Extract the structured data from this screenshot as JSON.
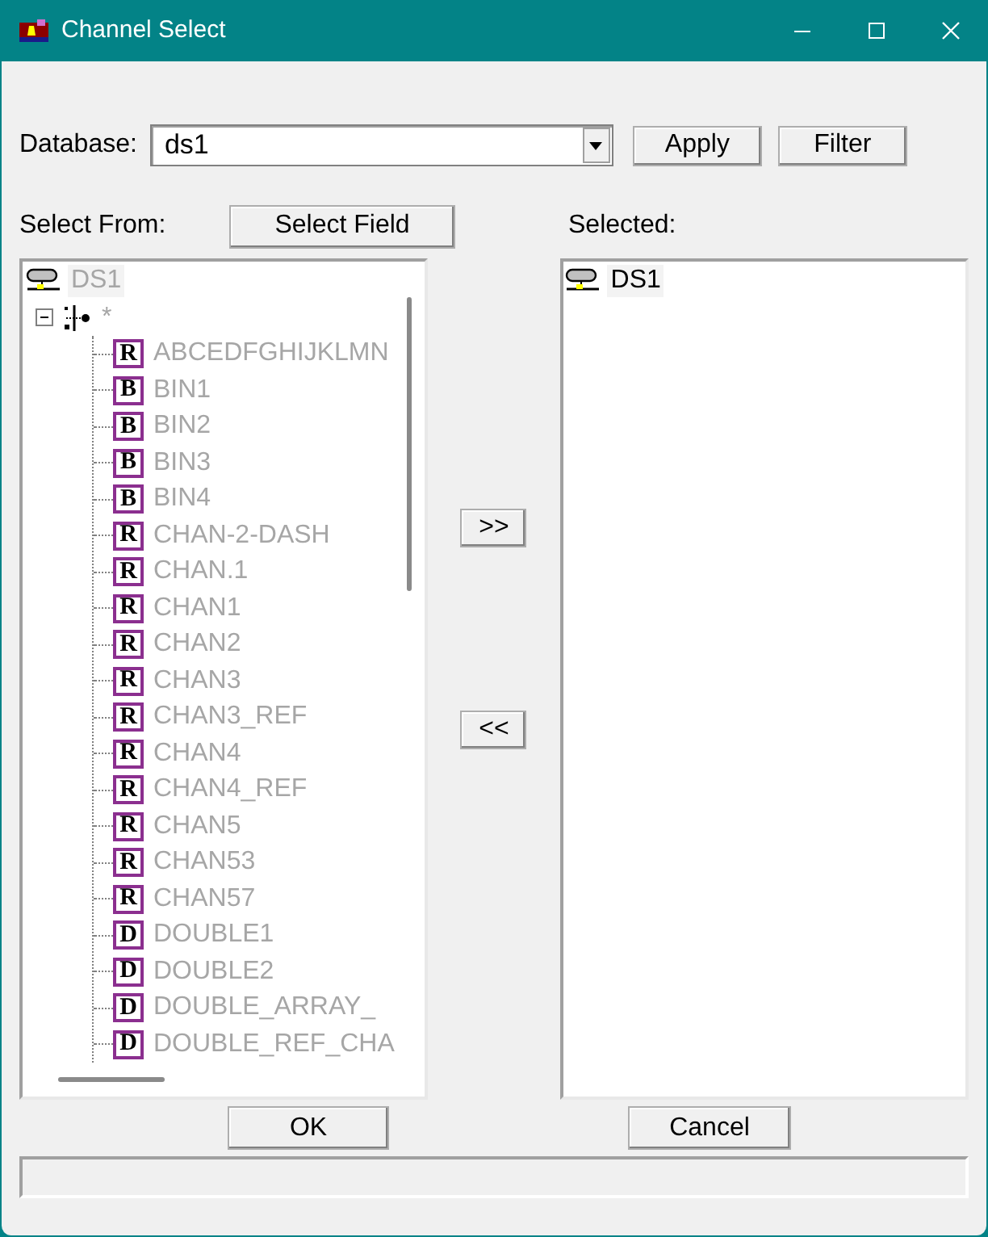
{
  "window": {
    "title": "Channel Select"
  },
  "database": {
    "label": "Database:",
    "value": "ds1"
  },
  "buttons": {
    "apply": "Apply",
    "filter": "Filter",
    "select_field": "Select Field",
    "add": ">>",
    "remove": "<<",
    "ok": "OK",
    "cancel": "Cancel"
  },
  "select_from": {
    "label": "Select From:",
    "tree": [
      {
        "label": "DS1",
        "kind": "database",
        "disabled": true,
        "children": [
          {
            "label": "*",
            "kind": "group",
            "disabled": true,
            "expanded": true,
            "children": [
              {
                "label": "ABCEDFGHIJKLMN",
                "kind": "field",
                "badge": "R",
                "disabled": true
              },
              {
                "label": "BIN1",
                "kind": "field",
                "badge": "B",
                "disabled": true
              },
              {
                "label": "BIN2",
                "kind": "field",
                "badge": "B",
                "disabled": true
              },
              {
                "label": "BIN3",
                "kind": "field",
                "badge": "B",
                "disabled": true
              },
              {
                "label": "BIN4",
                "kind": "field",
                "badge": "B",
                "disabled": true
              },
              {
                "label": "CHAN-2-DASH",
                "kind": "field",
                "badge": "R",
                "disabled": true
              },
              {
                "label": "CHAN.1",
                "kind": "field",
                "badge": "R",
                "disabled": true
              },
              {
                "label": "CHAN1",
                "kind": "field",
                "badge": "R",
                "disabled": true
              },
              {
                "label": "CHAN2",
                "kind": "field",
                "badge": "R",
                "disabled": true
              },
              {
                "label": "CHAN3",
                "kind": "field",
                "badge": "R",
                "disabled": true
              },
              {
                "label": "CHAN3_REF",
                "kind": "field",
                "badge": "R",
                "disabled": true
              },
              {
                "label": "CHAN4",
                "kind": "field",
                "badge": "R",
                "disabled": true
              },
              {
                "label": "CHAN4_REF",
                "kind": "field",
                "badge": "R",
                "disabled": true
              },
              {
                "label": "CHAN5",
                "kind": "field",
                "badge": "R",
                "disabled": true
              },
              {
                "label": "CHAN53",
                "kind": "field",
                "badge": "R",
                "disabled": true
              },
              {
                "label": "CHAN57",
                "kind": "field",
                "badge": "R",
                "disabled": true
              },
              {
                "label": "DOUBLE1",
                "kind": "field",
                "badge": "D",
                "disabled": true
              },
              {
                "label": "DOUBLE2",
                "kind": "field",
                "badge": "D",
                "disabled": true
              },
              {
                "label": "DOUBLE_ARRAY_",
                "kind": "field",
                "badge": "D",
                "disabled": true
              },
              {
                "label": "DOUBLE_REF_CHA",
                "kind": "field",
                "badge": "D",
                "disabled": true
              }
            ]
          }
        ]
      }
    ]
  },
  "selected": {
    "label": "Selected:",
    "tree": [
      {
        "label": "DS1",
        "kind": "database",
        "disabled": false
      }
    ]
  }
}
